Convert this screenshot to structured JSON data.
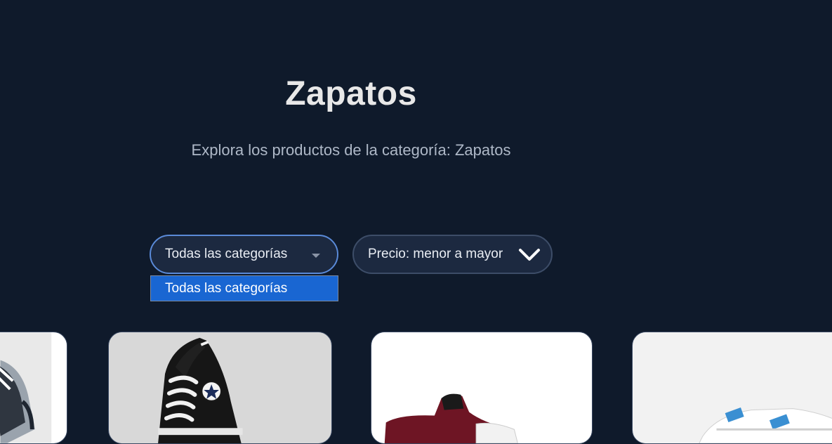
{
  "header": {
    "title": "Zapatos",
    "subtitle": "Explora los productos de la categoría: Zapatos"
  },
  "filters": {
    "category": {
      "selected": "Todas las categorías",
      "options": [
        "Todas las categorías"
      ]
    },
    "sort": {
      "selected": "Precio: menor a mayor"
    }
  },
  "products": [
    {
      "image": "sneaker-grey-icon"
    },
    {
      "image": "converse-black-hightop-icon"
    },
    {
      "image": "burgundy-hightop-icon"
    },
    {
      "image": "white-sneaker-blue-straps-icon"
    }
  ],
  "colors": {
    "background": "#0f1a2b",
    "accent": "#1966d2",
    "select_bg": "#1c2940"
  }
}
